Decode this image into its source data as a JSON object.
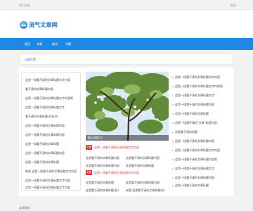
{
  "topbar": {
    "left": "首页导航",
    "right": "登录"
  },
  "logo": {
    "text": "流气文章网"
  },
  "nav": [
    "首页",
    "文章",
    "美文",
    "专题"
  ],
  "breadcrumb": "当前位置",
  "left_list": [
    "这是一段看不清的文章标题文字内容",
    "看不清的文章标题内容",
    "这是一段看不清的文章标题文字内容呢",
    "这是一段看不清的文章标题文字",
    "看不清的文章标题(含括号)",
    "这是一段看不清的文章标题内容",
    "这是一段看不清的文章标题内容",
    "这是一段看不清的文章标题",
    "这是一段看不清的文章标题内容",
    "这是一段看不清的文章标题",
    "新版 这是一段看不清的文章标题文字内容",
    "这是一段看不清的文章标题文字内容",
    "这是一段看不清的文章标题文字内容"
  ],
  "photo_caption": "图片标题文字",
  "hot_items": [
    {
      "tag": "头条",
      "title": "这是一段看不清的头条标题文字内容"
    },
    {
      "tag": "头条",
      "title": "这是一段看不清的头条标题文字内容"
    }
  ],
  "sub_items_a": [
    "这是看不清的文章标题内容",
    "这是看不清的文章标题内容",
    "这是看不清的文章标题",
    "这是看不清的文章标题(含)"
  ],
  "sub_items_b": [
    "这是看不清的文章标题内容",
    "这是看不清的文章标题",
    "这是看不清的文章标题内容",
    "新版 这是看不清的文章标题内容"
  ],
  "right_list": [
    "这是一段看不清的文章标题文字内容",
    "这是一段看不清的文章标题文字内容呢",
    "这是一段看不清的文章标题文字",
    "这是一段看不清的文章标题内容",
    "这是一段看不清的文章标题",
    "这是一段看不清的\"文章\"标题内容",
    "这是看不清的标题",
    "这是一段看不清的文章标题内容",
    "这是一段看不清的文章标题文字内容",
    "这是一段看不清的文章标题内容呢",
    "这是一段看不清的文章标题文字",
    "这是一段看不清的文章标题内容",
    "这是一段看不清的文章标题"
  ],
  "footer": "友情链接"
}
